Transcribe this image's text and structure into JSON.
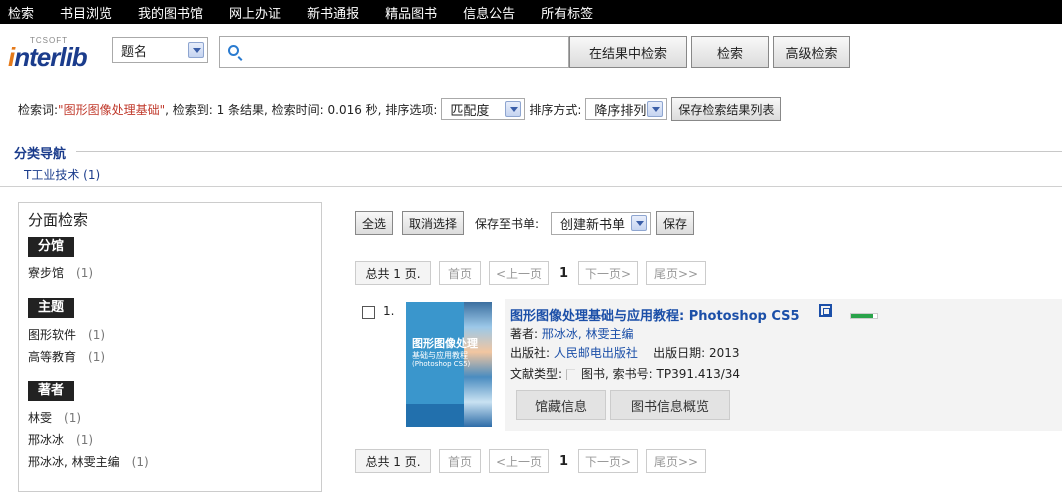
{
  "topnav": [
    "检索",
    "书目浏览",
    "我的图书馆",
    "网上办证",
    "新书通报",
    "精品图书",
    "信息公告",
    "所有标签"
  ],
  "logo": {
    "small": "TCSOFT",
    "text_i": "i",
    "text_rest": "nterlib"
  },
  "search": {
    "field_select": "题名",
    "value": "",
    "btn_in_results": "在结果中检索",
    "btn_search": "检索",
    "btn_advanced": "高级检索"
  },
  "info": {
    "prefix": "检索词: ",
    "keyword": "\"图形图像处理基础\"",
    "mid": ", 检索到: 1 条结果, 检索时间: 0.016 秒, 排序选项:",
    "sort_option": "匹配度",
    "sort_way_label": "排序方式:",
    "sort_way": "降序排列",
    "save_btn": "保存检索结果列表"
  },
  "classnav": {
    "title": "分类导航",
    "link": "T工业技术 (1)"
  },
  "facet": {
    "title": "分面检索",
    "groups": [
      {
        "head": "分馆",
        "items": [
          {
            "label": "寮步馆",
            "count": "(1)"
          }
        ]
      },
      {
        "head": "主题",
        "items": [
          {
            "label": "图形软件",
            "count": "(1)"
          },
          {
            "label": "高等教育",
            "count": "(1)"
          }
        ]
      },
      {
        "head": "著者",
        "items": [
          {
            "label": "林雯",
            "count": "(1)"
          },
          {
            "label": "邢冰冰",
            "count": "(1)"
          },
          {
            "label": "邢冰冰, 林雯主编",
            "count": "(1)"
          }
        ]
      }
    ]
  },
  "toolbar": {
    "select_all": "全选",
    "cancel": "取消选择",
    "save_to_label": "保存至书单:",
    "booklist": "创建新书单",
    "save": "保存"
  },
  "pager": {
    "total": "总共 1 页.",
    "first": "首页",
    "prev": "<上一页",
    "current": "1",
    "next": "下一页>",
    "last": "尾页>>"
  },
  "result": {
    "number": "1.",
    "title": "图形图像处理基础与应用教程: Photoshop CS5",
    "author_label": "著者:",
    "author": "邢冰冰, 林雯主编",
    "publisher_label": "出版社:",
    "publisher": "人民邮电出版社",
    "date_label": "出版日期:",
    "date": "2013",
    "doctype_label": "文献类型:",
    "doctype": "图书, 索书号: TP391.413/34",
    "tab_holdings": "馆藏信息",
    "tab_overview": "图书信息概览",
    "availability_fraction": 0.85,
    "cover_title": "图形图像处理",
    "cover_sub": "基础与应用教程",
    "cover_sub2": "(Photoshop CS5)"
  }
}
